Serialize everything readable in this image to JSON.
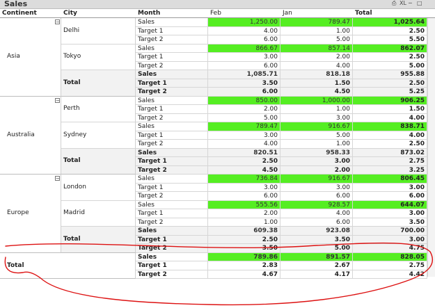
{
  "window": {
    "title": "Sales",
    "xl_label": "XL"
  },
  "headers": {
    "continent": "Continent",
    "city": "City",
    "month": "Month",
    "feb": "Feb",
    "jan": "Jan",
    "total": "Total"
  },
  "colors": {
    "highlight": "#55ee22",
    "annotation": "#dd1111"
  },
  "continents": [
    {
      "name": "Asia",
      "total_label": "Total",
      "cities": [
        {
          "name": "Delhi",
          "rows": [
            {
              "label": "Sales",
              "feb": "1,250.00",
              "jan": "789.47",
              "total": "1,025.64",
              "highlight": true
            },
            {
              "label": "Target 1",
              "feb": "4.00",
              "jan": "1.00",
              "total": "2.50"
            },
            {
              "label": "Target 2",
              "feb": "6.00",
              "jan": "5.00",
              "total": "5.50"
            }
          ]
        },
        {
          "name": "Tokyo",
          "rows": [
            {
              "label": "Sales",
              "feb": "866.67",
              "jan": "857.14",
              "total": "862.07",
              "highlight": true
            },
            {
              "label": "Target 1",
              "feb": "3.00",
              "jan": "2.00",
              "total": "2.50"
            },
            {
              "label": "Target 2",
              "feb": "6.00",
              "jan": "4.00",
              "total": "5.00"
            }
          ]
        }
      ],
      "totals": [
        {
          "label": "Sales",
          "feb": "1,085.71",
          "jan": "818.18",
          "total": "955.88",
          "highlight": true
        },
        {
          "label": "Target 1",
          "feb": "3.50",
          "jan": "1.50",
          "total": "2.50"
        },
        {
          "label": "Target 2",
          "feb": "6.00",
          "jan": "4.50",
          "total": "5.25"
        }
      ]
    },
    {
      "name": "Australia",
      "total_label": "Total",
      "cities": [
        {
          "name": "Perth",
          "rows": [
            {
              "label": "Sales",
              "feb": "850.00",
              "jan": "1,000.00",
              "total": "906.25",
              "highlight": true
            },
            {
              "label": "Target 1",
              "feb": "2.00",
              "jan": "1.00",
              "total": "1.50"
            },
            {
              "label": "Target 2",
              "feb": "5.00",
              "jan": "3.00",
              "total": "4.00"
            }
          ]
        },
        {
          "name": "Sydney",
          "rows": [
            {
              "label": "Sales",
              "feb": "789.47",
              "jan": "916.67",
              "total": "838.71",
              "highlight": true
            },
            {
              "label": "Target 1",
              "feb": "3.00",
              "jan": "5.00",
              "total": "4.00"
            },
            {
              "label": "Target 2",
              "feb": "4.00",
              "jan": "1.00",
              "total": "2.50"
            }
          ]
        }
      ],
      "totals": [
        {
          "label": "Sales",
          "feb": "820.51",
          "jan": "958.33",
          "total": "873.02",
          "highlight": true
        },
        {
          "label": "Target 1",
          "feb": "2.50",
          "jan": "3.00",
          "total": "2.75"
        },
        {
          "label": "Target 2",
          "feb": "4.50",
          "jan": "2.00",
          "total": "3.25"
        }
      ]
    },
    {
      "name": "Europe",
      "total_label": "Total",
      "cities": [
        {
          "name": "London",
          "rows": [
            {
              "label": "Sales",
              "feb": "736.84",
              "jan": "916.67",
              "total": "806.45",
              "highlight": true
            },
            {
              "label": "Target 1",
              "feb": "3.00",
              "jan": "3.00",
              "total": "3.00"
            },
            {
              "label": "Target 2",
              "feb": "6.00",
              "jan": "6.00",
              "total": "6.00"
            }
          ]
        },
        {
          "name": "Madrid",
          "rows": [
            {
              "label": "Sales",
              "feb": "555.56",
              "jan": "928.57",
              "total": "644.07",
              "highlight": true
            },
            {
              "label": "Target 1",
              "feb": "2.00",
              "jan": "4.00",
              "total": "3.00"
            },
            {
              "label": "Target 2",
              "feb": "1.00",
              "jan": "6.00",
              "total": "3.50"
            }
          ]
        }
      ],
      "totals": [
        {
          "label": "Sales",
          "feb": "609.38",
          "jan": "923.08",
          "total": "700.00",
          "highlight": true
        },
        {
          "label": "Target 1",
          "feb": "2.50",
          "jan": "3.50",
          "total": "3.00"
        },
        {
          "label": "Target 2",
          "feb": "3.50",
          "jan": "5.00",
          "total": "4.75"
        }
      ]
    }
  ],
  "grand_total": {
    "label": "Total",
    "rows": [
      {
        "label": "Sales",
        "feb": "789.86",
        "jan": "891.57",
        "total": "828.05",
        "highlight": true
      },
      {
        "label": "Target 1",
        "feb": "2.83",
        "jan": "2.67",
        "total": "2.75"
      },
      {
        "label": "Target 2",
        "feb": "4.67",
        "jan": "4.17",
        "total": "4.42"
      }
    ]
  }
}
